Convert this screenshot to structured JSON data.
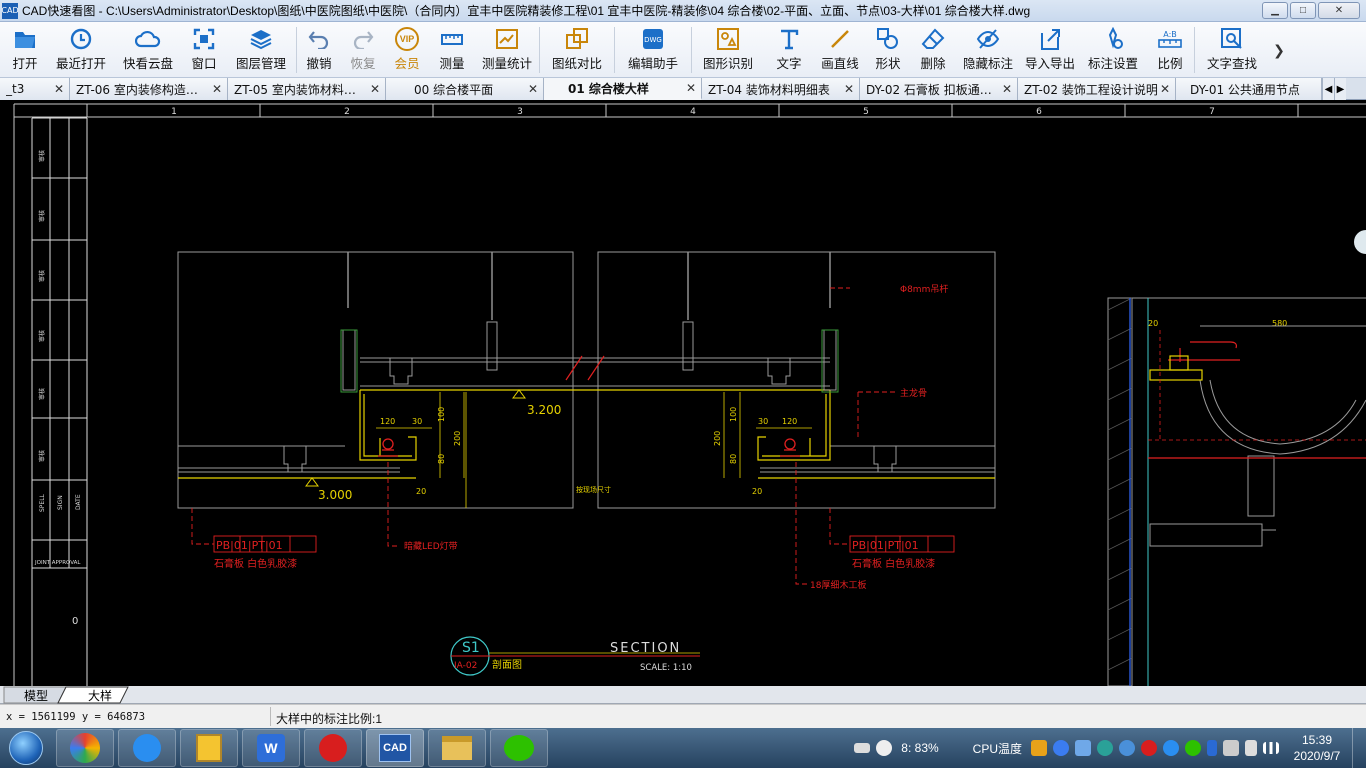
{
  "window": {
    "title": "CAD快速看图 - C:\\Users\\Administrator\\Desktop\\图纸\\中医院图纸\\中医院\\（合同内）宜丰中医院精装修工程\\01 宜丰中医院-精装修\\04 综合楼\\02-平面、立面、节点\\03-大样\\01  综合楼大样.dwg",
    "icon_text": "CAD",
    "minimize": "▁",
    "maximize": "□",
    "close": "✕"
  },
  "toolbar": {
    "items": [
      {
        "label": "打开",
        "icon": "folder-open-icon"
      },
      {
        "label": "最近打开",
        "icon": "recent-icon"
      },
      {
        "label": "快看云盘",
        "icon": "cloud-icon"
      },
      {
        "label": "窗口",
        "icon": "window-icon"
      },
      {
        "label": "图层管理",
        "icon": "layers-icon"
      },
      {
        "label": "撤销",
        "icon": "undo-icon"
      },
      {
        "label": "恢复",
        "icon": "redo-icon"
      },
      {
        "label": "会员",
        "icon": "vip-icon"
      },
      {
        "label": "测量",
        "icon": "ruler-icon"
      },
      {
        "label": "测量统计",
        "icon": "measure-stats-icon"
      },
      {
        "label": "图纸对比",
        "icon": "compare-icon"
      },
      {
        "label": "编辑助手",
        "icon": "edit-assistant-icon"
      },
      {
        "label": "图形识别",
        "icon": "shape-recognition-icon"
      },
      {
        "label": "文字",
        "icon": "text-icon"
      },
      {
        "label": "画直线",
        "icon": "line-icon"
      },
      {
        "label": "形状",
        "icon": "shapes-icon"
      },
      {
        "label": "删除",
        "icon": "eraser-icon"
      },
      {
        "label": "隐藏标注",
        "icon": "hide-annotation-icon"
      },
      {
        "label": "导入导出",
        "icon": "import-export-icon"
      },
      {
        "label": "标注设置",
        "icon": "annotation-settings-icon"
      },
      {
        "label": "比例",
        "icon": "scale-icon"
      },
      {
        "label": "文字查找",
        "icon": "text-search-icon"
      }
    ],
    "vip_badge": "VIP",
    "more_arrow": "❯"
  },
  "tabs": [
    {
      "label": "_t3"
    },
    {
      "label": "ZT-06 室内装修构造…"
    },
    {
      "label": "ZT-05 室内装饰材料…"
    },
    {
      "label": "00  综合楼平面"
    },
    {
      "label": "01  综合楼大样"
    },
    {
      "label": "ZT-04 装饰材料明细表"
    },
    {
      "label": "DY-02 石膏板 扣板通…"
    },
    {
      "label": "ZT-02 装饰工程设计说明"
    },
    {
      "label": "DY-01 公共通用节点"
    }
  ],
  "tab_close": "✕",
  "tab_prev": "◀",
  "tab_next": "▶",
  "drawing": {
    "ruler_numbers": [
      "1",
      "2",
      "3",
      "4",
      "5",
      "6",
      "7"
    ],
    "title_block": {
      "labels": [
        "SPELL",
        "SIGN",
        "DATE"
      ],
      "bottom_label": "JOINT APPROVAL",
      "row_text": "审核",
      "side_digit": "0"
    },
    "annotations": {
      "level_1": "3.200",
      "level_2": "3.000",
      "wire": "Φ8mm吊杆",
      "main_keel": "主龙骨",
      "led": "暗藏LED灯带",
      "board": "18厚细木工板",
      "ceiling_size": "按现场尺寸",
      "mat_left_1": "PB|01|PT|01",
      "mat_left_2": "石膏板     白色乳胶漆",
      "mat_right_1": "PB|01|PT|01",
      "mat_right_2": "石膏板     白色乳胶漆",
      "dim_120": "120",
      "dim_30": "30",
      "dim_100": "100",
      "dim_200": "200",
      "dim_80": "80",
      "dim_20": "20",
      "dim_580": "580"
    },
    "section_label": {
      "id": "S1",
      "sheet": "IA-02",
      "name": "剖面图",
      "title": "SECTION",
      "scale": "SCALE: 1:10"
    }
  },
  "sheet_tabs": [
    {
      "label": "模型",
      "active": false
    },
    {
      "label": "大样",
      "active": true
    }
  ],
  "status": {
    "coordinates": "x = 1561199  y = 646873",
    "scale_note": "大样中的标注比例:1"
  },
  "taskbar": {
    "apps": [
      "browser-icon",
      "feishu-icon",
      "notes-icon",
      "wps-icon",
      "netease-music-icon",
      "cad-icon",
      "explorer-icon",
      "wechat-icon"
    ],
    "cad_label": "CAD",
    "tray_text_1": "8: 83%",
    "tray_text_2": "CPU温度",
    "time": "15:39",
    "date": "2020/9/7"
  }
}
